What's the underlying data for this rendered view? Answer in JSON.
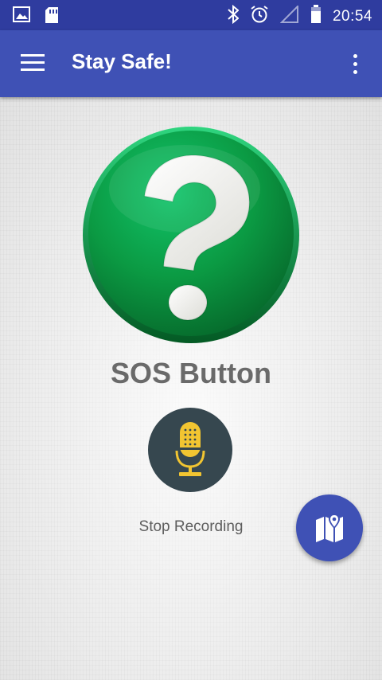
{
  "status_bar": {
    "time": "20:54",
    "left_icons": [
      "image-icon",
      "sd-card-icon"
    ],
    "right_icons": [
      "bluetooth-icon",
      "alarm-icon",
      "signal-icon",
      "battery-icon"
    ]
  },
  "app_bar": {
    "title": "Stay Safe!",
    "menu_icon": "hamburger-menu-icon",
    "overflow_icon": "more-vert-icon"
  },
  "main": {
    "sos_icon": "question-mark-icon",
    "sos_label": "SOS Button",
    "mic_icon": "microphone-icon",
    "recording_label": "Stop Recording",
    "map_icon": "map-icon"
  },
  "colors": {
    "status_bar": "#2f3c9f",
    "app_bar": "#3f51b5",
    "sos_green": "#0e9a44",
    "mic_background": "#36474f",
    "mic_yellow": "#f2c531",
    "fab": "#3f51b5"
  }
}
